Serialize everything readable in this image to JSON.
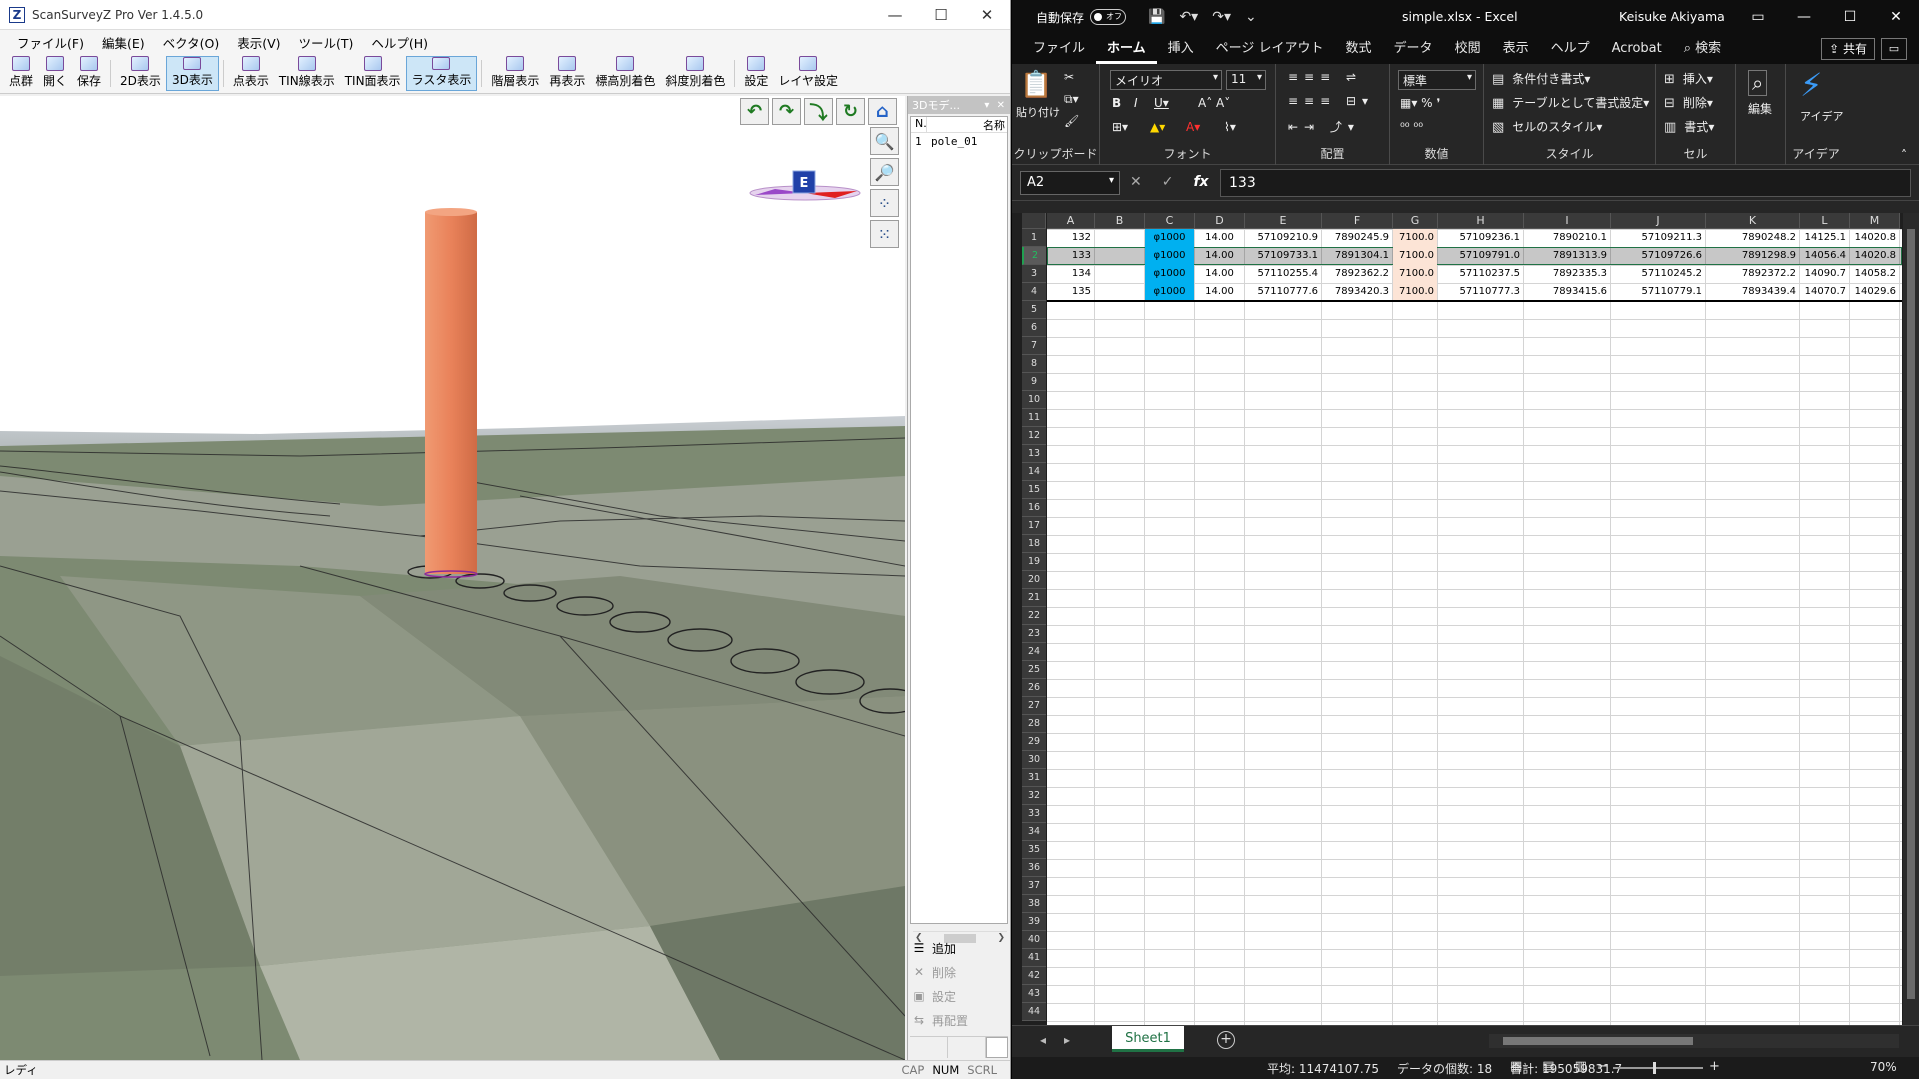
{
  "left_app": {
    "title": "ScanSurveyZ Pro  Ver 1.4.5.0",
    "menu": [
      "ファイル(F)",
      "編集(E)",
      "ベクタ(O)",
      "表示(V)",
      "ツール(T)",
      "ヘルプ(H)"
    ],
    "toolbar": [
      {
        "label": "点群",
        "icon": "point-cloud-icon"
      },
      {
        "label": "開く",
        "icon": "open-icon"
      },
      {
        "label": "保存",
        "icon": "save-icon"
      },
      {
        "label": "2D表示",
        "icon": "view-2d-icon"
      },
      {
        "label": "3D表示",
        "icon": "view-3d-icon",
        "active": true
      },
      {
        "label": "点表示",
        "icon": "point-display-icon"
      },
      {
        "label": "TIN線表示",
        "icon": "tin-line-icon"
      },
      {
        "label": "TIN面表示",
        "icon": "tin-face-icon"
      },
      {
        "label": "ラスタ表示",
        "icon": "raster-icon",
        "active": true
      },
      {
        "label": "階層表示",
        "icon": "hierarchy-icon"
      },
      {
        "label": "再表示",
        "icon": "refresh-icon"
      },
      {
        "label": "標高別着色",
        "icon": "elevation-color-icon"
      },
      {
        "label": "斜度別着色",
        "icon": "slope-color-icon"
      },
      {
        "label": "設定",
        "icon": "settings-icon"
      },
      {
        "label": "レイヤ設定",
        "icon": "layer-settings-icon"
      }
    ],
    "view_controls": [
      "rotate-left-icon",
      "rotate-up-icon",
      "rotate-down-icon",
      "rotate-right-icon",
      "home-icon"
    ],
    "zoom_controls": [
      "zoom-in-icon",
      "zoom-out-icon",
      "add-point-icon",
      "remove-point-icon"
    ],
    "gizmo_label": "E",
    "model_panel": {
      "title": "3Dモデ...",
      "col_no": "N.",
      "col_name": "名称",
      "rows": [
        {
          "no": "1",
          "name": "pole_01"
        }
      ],
      "actions": [
        {
          "label": "追加",
          "icon": "add-icon",
          "enabled": true
        },
        {
          "label": "削除",
          "icon": "delete-icon",
          "enabled": false
        },
        {
          "label": "設定",
          "icon": "settings-icon",
          "enabled": false
        },
        {
          "label": "再配置",
          "icon": "relocate-icon",
          "enabled": false
        }
      ]
    },
    "status": "レディ",
    "keys": [
      {
        "label": "CAP",
        "on": false
      },
      {
        "label": "NUM",
        "on": true
      },
      {
        "label": "SCRL",
        "on": false
      }
    ],
    "colors": {
      "pole": "#e9825a",
      "terrain": "#7d8a72",
      "sky": "#ffffff"
    }
  },
  "excel": {
    "autosave": "自動保存",
    "autosave_state": "オフ",
    "doc_title": "simple.xlsx  -  Excel",
    "user": "Keisuke Akiyama",
    "tabs": [
      "ファイル",
      "ホーム",
      "挿入",
      "ページ レイアウト",
      "数式",
      "データ",
      "校閲",
      "表示",
      "ヘルプ",
      "Acrobat",
      "検索"
    ],
    "active_tab": "ホーム",
    "share": "共有",
    "ribbon": {
      "paste": "貼り付け",
      "clipboard": "クリップボード",
      "font_name": "メイリオ",
      "font_size": "11",
      "font": "フォント",
      "alignment": "配置",
      "number_format": "標準",
      "number": "数値",
      "conditional": "条件付き書式",
      "table_format": "テーブルとして書式設定",
      "cell_style": "セルのスタイル",
      "style": "スタイル",
      "insert": "挿入",
      "delete": "削除",
      "format": "書式",
      "cells": "セル",
      "edit": "編集",
      "ideas": "アイデア",
      "ideas_group": "アイデア"
    },
    "namebox": "A2",
    "formula": "133",
    "columns": [
      "A",
      "B",
      "C",
      "D",
      "E",
      "F",
      "G",
      "H",
      "I",
      "J",
      "K",
      "L",
      "M"
    ],
    "rows": [
      [
        "132",
        "",
        "φ1000",
        "14.00",
        "57109210.9",
        "7890245.9",
        "7100.0",
        "57109236.1",
        "7890210.1",
        "57109211.3",
        "7890248.2",
        "14125.1",
        "14020.8"
      ],
      [
        "133",
        "",
        "φ1000",
        "14.00",
        "57109733.1",
        "7891304.1",
        "7100.0",
        "57109791.0",
        "7891313.9",
        "57109726.6",
        "7891298.9",
        "14056.4",
        "14020.8"
      ],
      [
        "134",
        "",
        "φ1000",
        "14.00",
        "57110255.4",
        "7892362.2",
        "7100.0",
        "57110237.5",
        "7892335.3",
        "57110245.2",
        "7892372.2",
        "14090.7",
        "14058.2"
      ],
      [
        "135",
        "",
        "φ1000",
        "14.00",
        "57110777.6",
        "7893420.3",
        "7100.0",
        "57110777.3",
        "7893415.6",
        "57110779.1",
        "7893439.4",
        "14070.7",
        "14029.6"
      ]
    ],
    "row_count": 44,
    "sheet": "Sheet1",
    "status": {
      "avg": "平均: 11474107.75",
      "count": "データの個数: 18",
      "sum": "合計: 195059831.7"
    },
    "zoom": "70%"
  }
}
